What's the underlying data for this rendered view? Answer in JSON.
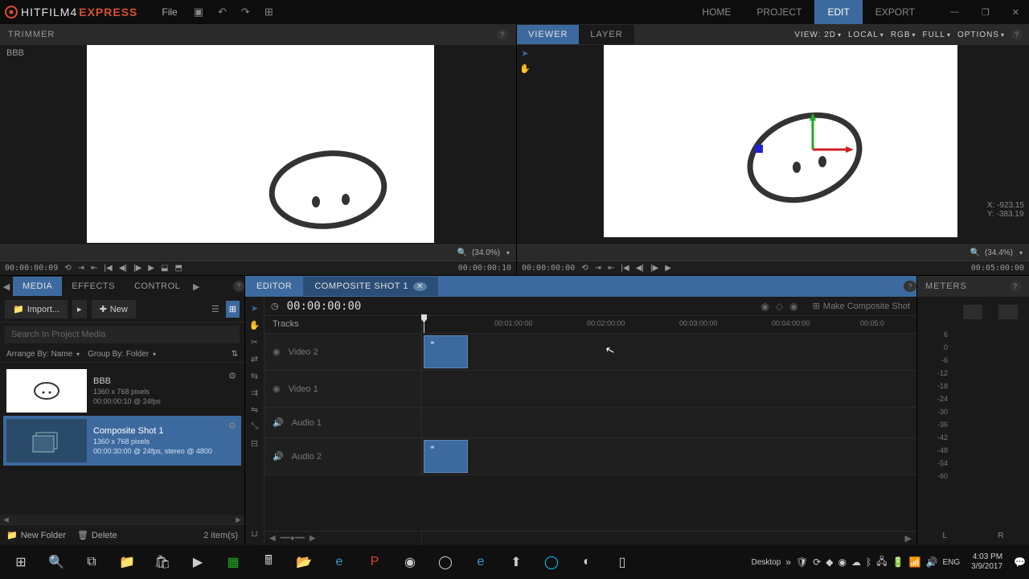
{
  "app": {
    "name1": "HITFILM4",
    "name2": "EXPRESS"
  },
  "menu": {
    "file": "File"
  },
  "topTabs": {
    "home": "HOME",
    "project": "PROJECT",
    "edit": "EDIT",
    "export": "EXPORT"
  },
  "trimmer": {
    "title": "TRIMMER",
    "source": "BBB",
    "zoom": "(34.0%)",
    "tc_left": "00:00:00:09",
    "tc_right": "00:00:00:10"
  },
  "viewer": {
    "tabs": {
      "viewer": "VIEWER",
      "layer": "LAYER"
    },
    "opts": {
      "view": "VIEW: 2D",
      "space": "LOCAL",
      "channel": "RGB",
      "quality": "FULL",
      "options": "OPTIONS"
    },
    "coords": {
      "x": "X:   -923.15",
      "y": "Y:   -383.19"
    },
    "zoom": "(34.4%)",
    "tc_left": "00:00:00:00",
    "tc_right": "00:05:00:00"
  },
  "media": {
    "tabs": {
      "media": "MEDIA",
      "effects": "EFFECTS",
      "control": "CONTROL"
    },
    "import": "Import...",
    "new": "New",
    "search_ph": "Search In Project Media",
    "arrange": "Arrange By: Name",
    "group": "Group By: Folder",
    "items": [
      {
        "name": "BBB",
        "dim": "1360 x 768 pixels",
        "info": "00:00:00:10 @ 24fps"
      },
      {
        "name": "Composite Shot 1",
        "dim": "1360 x 768 pixels",
        "info": "00:00:30:00 @ 24fps, stereo @ 4800"
      }
    ],
    "newfolder": "New Folder",
    "delete": "Delete",
    "count": "2 item(s)"
  },
  "editor": {
    "tabs": {
      "editor": "EDITOR",
      "comp": "COMPOSITE SHOT 1"
    },
    "tc": "00:00:00:00",
    "makecomp": "Make Composite Shot",
    "tracks_label": "Tracks",
    "ruler": [
      "00:01:00:00",
      "00:02:00:00",
      "00:03:00:00",
      "00:04:00:00",
      "00:05:0"
    ],
    "tracks": {
      "v2": "Video 2",
      "v1": "Video 1",
      "a1": "Audio 1",
      "a2": "Audio 2"
    }
  },
  "meters": {
    "title": "METERS",
    "scale": [
      "6",
      "0",
      "-6",
      "-12",
      "-18",
      "-24",
      "-30",
      "-36",
      "-42",
      "-48",
      "-54",
      "-60"
    ],
    "l": "L",
    "r": "R"
  },
  "taskbar": {
    "desktop": "Desktop",
    "lang": "ENG",
    "time": "4:03 PM",
    "date": "3/9/2017"
  },
  "chevron": "▾"
}
